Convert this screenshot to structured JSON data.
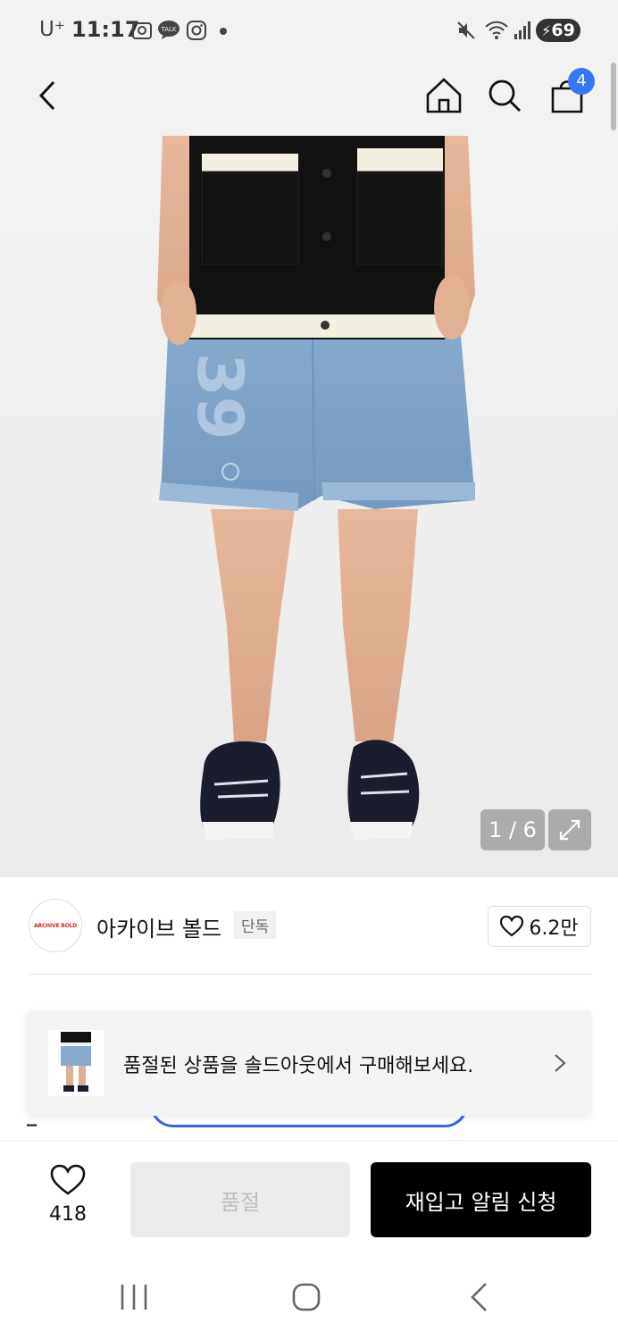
{
  "status_bar": {
    "carrier": "U⁺",
    "time": "11:17",
    "battery": "69",
    "icons": [
      "screenshot-icon",
      "kakaotalk-icon",
      "instagram-icon",
      "dot-icon",
      "mute-icon",
      "wifi-icon",
      "signal-icon",
      "battery-icon"
    ]
  },
  "nav": {
    "cart_count": "4",
    "icons": [
      "back-arrow-icon",
      "home-icon",
      "search-icon",
      "shopping-bag-icon"
    ]
  },
  "gallery": {
    "counter": "1 / 6",
    "print_text": "39"
  },
  "brand": {
    "logo_text": "ARCHIVE BOLD",
    "name": "아카이브 볼드",
    "tag": "단독",
    "likes": "6.2만"
  },
  "toast": {
    "message": "품절된 상품을 솔드아웃에서 구매해보세요."
  },
  "partially_hidden": {
    "char": "᠆"
  },
  "bottom_bar": {
    "wish_count": "418",
    "soldout_label": "품절",
    "restock_label": "재입고 알림 신청"
  },
  "colors": {
    "accent_blue": "#3478f6",
    "black": "#000000",
    "brand_red": "#d42a1e"
  }
}
